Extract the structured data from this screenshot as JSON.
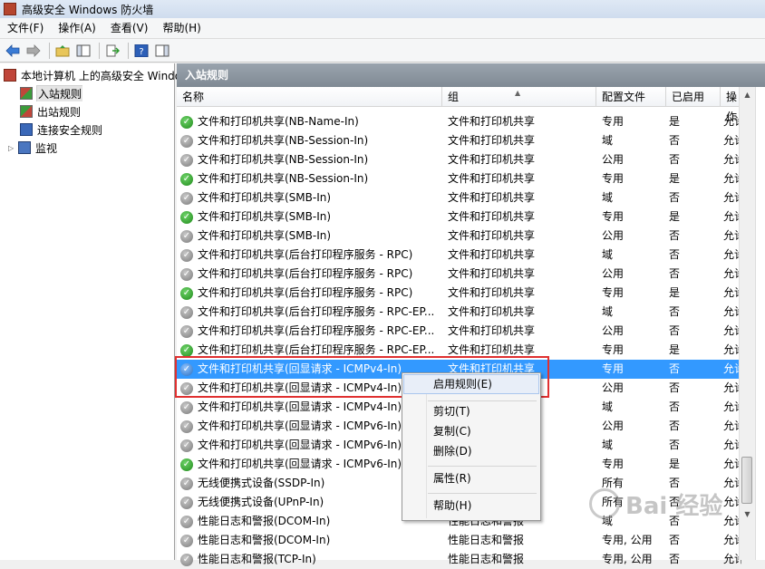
{
  "window": {
    "title": "高级安全 Windows 防火墙"
  },
  "menubar": {
    "items": [
      "文件(F)",
      "操作(A)",
      "查看(V)",
      "帮助(H)"
    ]
  },
  "toolbar": {
    "icons": [
      "back-arrow-icon",
      "forward-arrow-icon",
      "up-folder-icon",
      "show-hide-tree-icon",
      "export-list-icon",
      "help-icon",
      "show-hide-action-pane-icon"
    ]
  },
  "tree": {
    "root": "本地计算机 上的高级安全 Windows",
    "inbound": "入站规则",
    "outbound": "出站规则",
    "connection": "连接安全规则",
    "monitor": "监视"
  },
  "pane": {
    "title": "入站规则",
    "columns": {
      "name": "名称",
      "group": "组",
      "profile": "配置文件",
      "enabled": "已启用",
      "action": "操作"
    }
  },
  "rows": [
    {
      "name": "文件和打印机共享(NB-Name-In)",
      "group": "文件和打印机共享",
      "profile": "专用",
      "enabled": "是",
      "action": "允许",
      "status": "on"
    },
    {
      "name": "文件和打印机共享(NB-Session-In)",
      "group": "文件和打印机共享",
      "profile": "域",
      "enabled": "否",
      "action": "允许",
      "status": "off"
    },
    {
      "name": "文件和打印机共享(NB-Session-In)",
      "group": "文件和打印机共享",
      "profile": "公用",
      "enabled": "否",
      "action": "允许",
      "status": "off"
    },
    {
      "name": "文件和打印机共享(NB-Session-In)",
      "group": "文件和打印机共享",
      "profile": "专用",
      "enabled": "是",
      "action": "允许",
      "status": "on"
    },
    {
      "name": "文件和打印机共享(SMB-In)",
      "group": "文件和打印机共享",
      "profile": "域",
      "enabled": "否",
      "action": "允许",
      "status": "off"
    },
    {
      "name": "文件和打印机共享(SMB-In)",
      "group": "文件和打印机共享",
      "profile": "专用",
      "enabled": "是",
      "action": "允许",
      "status": "on"
    },
    {
      "name": "文件和打印机共享(SMB-In)",
      "group": "文件和打印机共享",
      "profile": "公用",
      "enabled": "否",
      "action": "允许",
      "status": "off"
    },
    {
      "name": "文件和打印机共享(后台打印程序服务 - RPC)",
      "group": "文件和打印机共享",
      "profile": "域",
      "enabled": "否",
      "action": "允许",
      "status": "off"
    },
    {
      "name": "文件和打印机共享(后台打印程序服务 - RPC)",
      "group": "文件和打印机共享",
      "profile": "公用",
      "enabled": "否",
      "action": "允许",
      "status": "off"
    },
    {
      "name": "文件和打印机共享(后台打印程序服务 - RPC)",
      "group": "文件和打印机共享",
      "profile": "专用",
      "enabled": "是",
      "action": "允许",
      "status": "on"
    },
    {
      "name": "文件和打印机共享(后台打印程序服务 - RPC-EP...",
      "group": "文件和打印机共享",
      "profile": "域",
      "enabled": "否",
      "action": "允许",
      "status": "off"
    },
    {
      "name": "文件和打印机共享(后台打印程序服务 - RPC-EP...",
      "group": "文件和打印机共享",
      "profile": "公用",
      "enabled": "否",
      "action": "允许",
      "status": "off"
    },
    {
      "name": "文件和打印机共享(后台打印程序服务 - RPC-EP...",
      "group": "文件和打印机共享",
      "profile": "专用",
      "enabled": "是",
      "action": "允许",
      "status": "on"
    },
    {
      "name": "文件和打印机共享(回显请求 - ICMPv4-In)",
      "group": "文件和打印机共享",
      "profile": "专用",
      "enabled": "否",
      "action": "允许",
      "status": "off",
      "selected": true
    },
    {
      "name": "文件和打印机共享(回显请求 - ICMPv4-In)",
      "group": "",
      "profile": "公用",
      "enabled": "否",
      "action": "允许",
      "status": "off"
    },
    {
      "name": "文件和打印机共享(回显请求 - ICMPv4-In)",
      "group": "",
      "profile": "域",
      "enabled": "否",
      "action": "允许",
      "status": "off"
    },
    {
      "name": "文件和打印机共享(回显请求 - ICMPv6-In)",
      "group": "",
      "profile": "公用",
      "enabled": "否",
      "action": "允许",
      "status": "off"
    },
    {
      "name": "文件和打印机共享(回显请求 - ICMPv6-In)",
      "group": "",
      "profile": "域",
      "enabled": "否",
      "action": "允许",
      "status": "off"
    },
    {
      "name": "文件和打印机共享(回显请求 - ICMPv6-In)",
      "group": "",
      "profile": "专用",
      "enabled": "是",
      "action": "允许",
      "status": "on"
    },
    {
      "name": "无线便携式设备(SSDP-In)",
      "group": "",
      "profile": "所有",
      "enabled": "否",
      "action": "允许",
      "status": "off"
    },
    {
      "name": "无线便携式设备(UPnP-In)",
      "group": "",
      "profile": "所有",
      "enabled": "否",
      "action": "允许",
      "status": "off"
    },
    {
      "name": "性能日志和警报(DCOM-In)",
      "group": "性能日志和警报",
      "profile": "域",
      "enabled": "否",
      "action": "允许",
      "status": "off"
    },
    {
      "name": "性能日志和警报(DCOM-In)",
      "group": "性能日志和警报",
      "profile": "专用, 公用",
      "enabled": "否",
      "action": "允许",
      "status": "off"
    },
    {
      "name": "性能日志和警报(TCP-In)",
      "group": "性能日志和警报",
      "profile": "专用, 公用",
      "enabled": "否",
      "action": "允许",
      "status": "off"
    }
  ],
  "context_menu": {
    "enable_rule": "启用规则(E)",
    "cut": "剪切(T)",
    "copy": "复制(C)",
    "delete": "删除(D)",
    "properties": "属性(R)",
    "help": "帮助(H)"
  },
  "watermark": "Bai 经验",
  "colors": {
    "selection": "#3399ff",
    "highlight_box": "#e03030",
    "enabled_icon": "#1f8a1a",
    "disabled_icon": "#7a7a7a"
  }
}
